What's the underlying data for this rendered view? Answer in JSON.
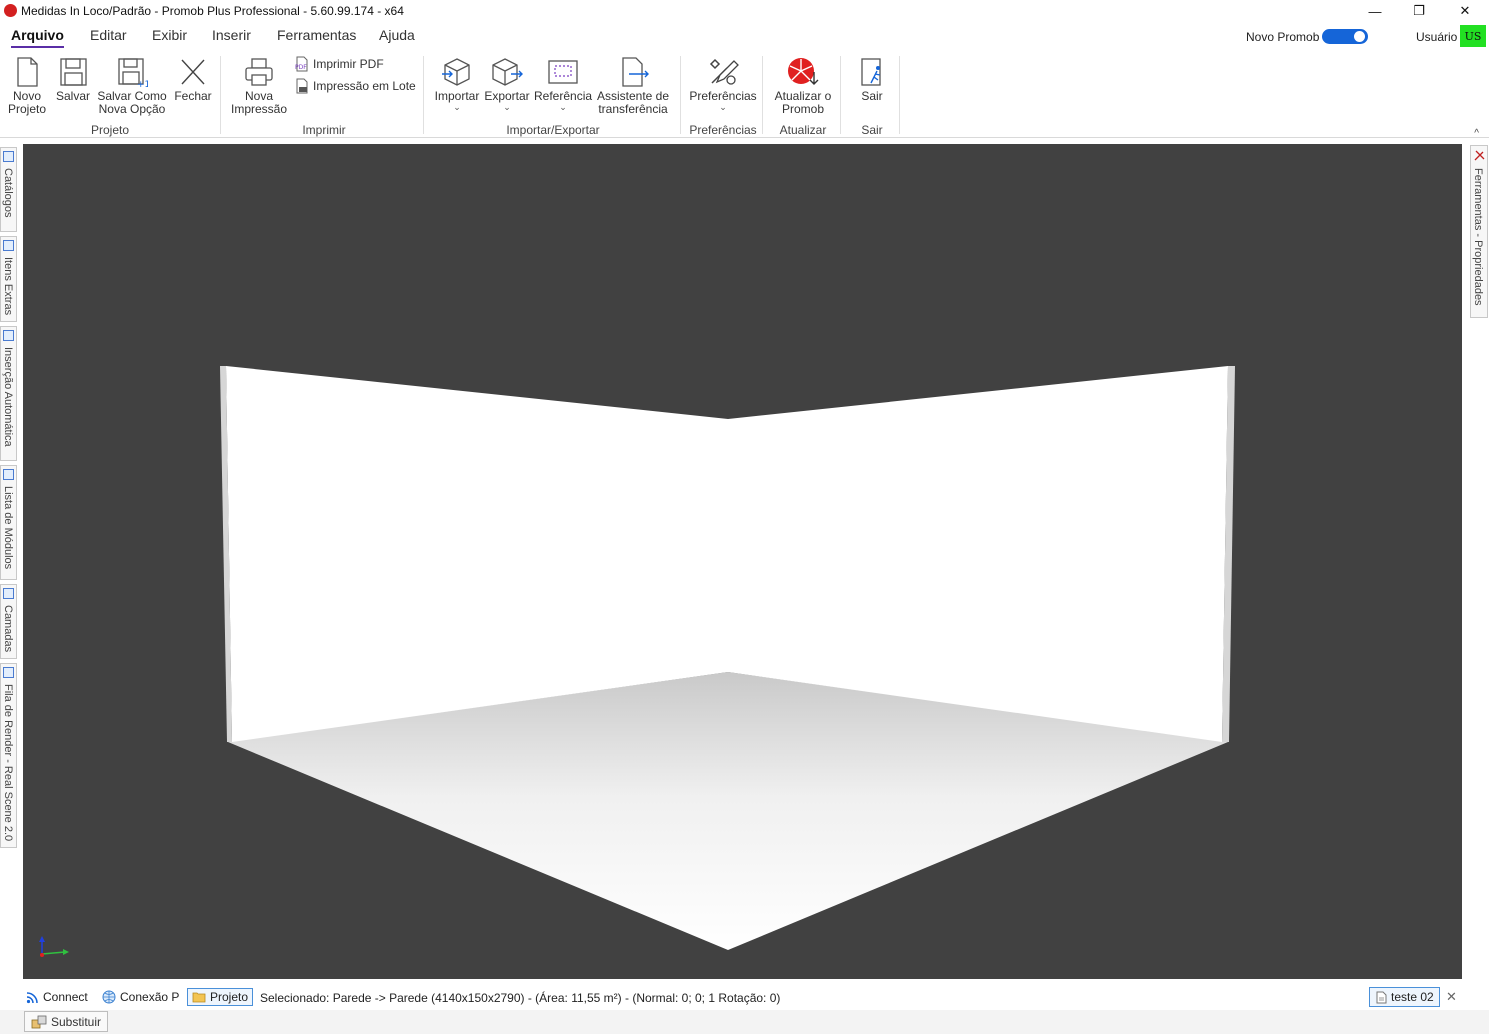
{
  "window": {
    "title": "Medidas In Loco/Padrão - Promob Plus Professional - 5.60.99.174 - x64",
    "minimize": "—",
    "maximize": "❐",
    "close": "✕"
  },
  "menu": {
    "items": [
      "Arquivo",
      "Editar",
      "Exibir",
      "Inserir",
      "Ferramentas",
      "Ajuda"
    ],
    "active": "Arquivo"
  },
  "header": {
    "novo_promob_label": "Novo Promob",
    "novo_promob_on": true,
    "user_label": "Usuário",
    "user_initials": "US",
    "avatar_color": "#22e022"
  },
  "ribbon": {
    "buttons": {
      "novo_projeto": "Novo\nProjeto",
      "salvar": "Salvar",
      "salvar_como": "Salvar Como\nNova Opção",
      "fechar": "Fechar",
      "nova_impressao": "Nova\nImpressão",
      "imprimir_pdf": "Imprimir PDF",
      "impressao_lote": "Impressão em Lote",
      "importar": "Importar",
      "exportar": "Exportar",
      "referencia": "Referência",
      "assistente": "Assistente de\ntransferência",
      "preferencias": "Preferências",
      "atualizar": "Atualizar o\nPromob",
      "sair": "Sair"
    },
    "groups": {
      "projeto": "Projeto",
      "imprimir": "Imprimir",
      "importar_exportar": "Importar/Exportar",
      "preferencias": "Preferências",
      "atualizar": "Atualizar",
      "sair": "Sair"
    },
    "collapse": "^"
  },
  "left_panels": [
    "Catálogos",
    "Itens Extras",
    "Inserção Automática",
    "Lista de Módulos",
    "Camadas",
    "Fila de Render - Real Scene 2.0"
  ],
  "right_panel": "Ferramentas - Propriedades",
  "status": {
    "connect": "Connect",
    "conexao": "Conexão P",
    "projeto": "Projeto",
    "selection": "Selecionado: Parede -> Parede (4140x150x2790) - (Área: 11,55 m²) - (Normal: 0; 0; 1 Rotação: 0)",
    "document_tab": "teste 02",
    "close": "✕"
  },
  "bottom": {
    "substituir": "Substituir"
  },
  "colors": {
    "viewport_bg": "#414141",
    "accent": "#5a2ea6",
    "toggle": "#1565d8",
    "update_red": "#e02020"
  }
}
